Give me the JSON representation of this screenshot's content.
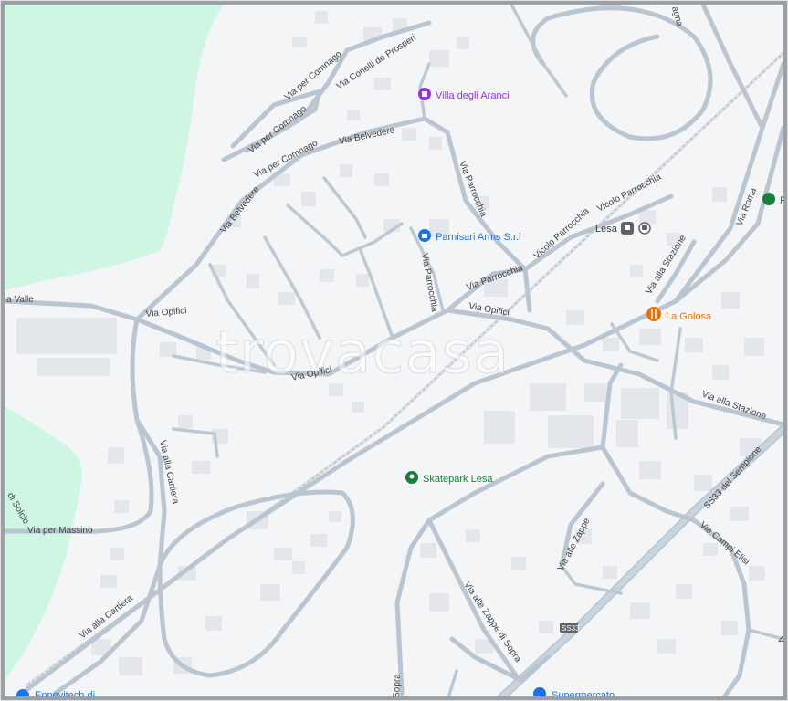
{
  "map": {
    "colors": {
      "background": "#f4f5f6",
      "park": "#cff5e3",
      "road": "#b9c6d1",
      "building": "#e3e6ea",
      "frame": "#9aa0a6",
      "poi_purple": "#9334e6",
      "poi_blue": "#1a73e8",
      "poi_orange": "#e8710a",
      "poi_green": "#188038",
      "railway": "#c4cbd2"
    },
    "watermark": "trovacasa",
    "streets": {
      "via_per_comnago_1": "Via per Comnago",
      "via_per_comnago_2": "Via per Comnago",
      "via_per_comnago_3": "Via per Comnago",
      "via_conelli": "Via Conelli de Prosperi",
      "via_belvedere_1": "Via Belvedere",
      "via_belvedere_2": "Via Belvedere",
      "via_parrocchia_1": "Via Parrocchia",
      "via_parrocchia_2": "Via Parrocchia",
      "via_parrocchia_3": "Via Parrocchia",
      "vicolo_parrocchia_1": "Vicolo Parrocchia",
      "vicolo_parrocchia_2": "Vicolo Parrocchia",
      "via_opifici_1": "Via Opifici",
      "via_opifici_2": "Via Opifici",
      "via_opifici_3": "Via Opifici",
      "via_opifici_4": "Via Opifici",
      "via_valle": "a Valle",
      "via_stazione_1": "Via alla Stazione",
      "via_stazione_2": "Via alla Stazione",
      "via_roma": "Via Roma",
      "via_cartiera_1": "Via alla Cartiera",
      "via_cartiera_2": "Via alla Cartiera",
      "via_massino": "Via per Massino",
      "via_solcio": "di Solcio",
      "ss33": "SS33 del Sempione",
      "via_campi_elisi": "Via Campi Elisi",
      "via_zappe": "Via alle Zappe",
      "via_zappe_sopra": "Via alle Zappe di Sopra",
      "sopra": "Sopra",
      "via_lagna": "agna",
      "via_v_edge": "V"
    },
    "places": {
      "lesa": "Lesa",
      "ss33_shield": "SS33"
    },
    "pois": {
      "villa": {
        "label": "Villa degli Aranci",
        "icon": "villa-icon"
      },
      "parnisari": {
        "label": "Parnisari Arms S.r.l",
        "icon": "shopping-bag-icon"
      },
      "golosa": {
        "label": "La Golosa",
        "icon": "restaurant-icon"
      },
      "skatepark": {
        "label": "Skatepark Lesa",
        "icon": "park-pin-icon"
      },
      "supermercato": {
        "label": "Supermercato",
        "icon": "shopping-cart-icon"
      },
      "ennevitech": {
        "label": "Ennevitech di",
        "icon": "business-pin-icon"
      },
      "right_edge": {
        "label": "P",
        "icon": "park-pin-icon"
      }
    }
  }
}
